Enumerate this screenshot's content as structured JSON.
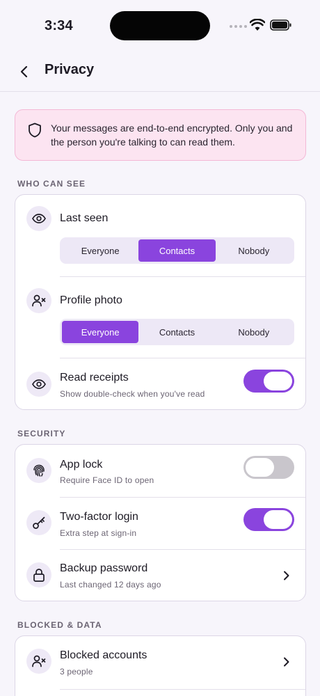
{
  "status_bar": {
    "time": "3:34"
  },
  "header": {
    "title": "Privacy"
  },
  "banner": {
    "text": "Your messages are end-to-end encrypted. Only you and the person you're talking to can read them."
  },
  "who_can_see": {
    "section_title": "WHO CAN SEE",
    "last_seen": {
      "label": "Last seen",
      "options": [
        "Everyone",
        "Contacts",
        "Nobody"
      ],
      "selected": "Contacts"
    },
    "profile_photo": {
      "label": "Profile photo",
      "options": [
        "Everyone",
        "Contacts",
        "Nobody"
      ],
      "selected": "Everyone"
    },
    "read_receipts": {
      "label": "Read receipts",
      "sub": "Show double-check when you've read",
      "enabled": true
    }
  },
  "security": {
    "section_title": "SECURITY",
    "app_lock": {
      "label": "App lock",
      "sub": "Require Face ID to open",
      "enabled": false
    },
    "two_factor": {
      "label": "Two-factor login",
      "sub": "Extra step at sign-in",
      "enabled": true
    },
    "backup_password": {
      "label": "Backup password",
      "sub": "Last changed 12 days ago"
    }
  },
  "blocked_data": {
    "section_title": "BLOCKED & DATA",
    "blocked_accounts": {
      "label": "Blocked accounts",
      "sub": "3 people"
    }
  },
  "colors": {
    "accent": "#8a44de",
    "banner_bg": "#fce4f1",
    "toggle_off": "#c9c6cc"
  }
}
